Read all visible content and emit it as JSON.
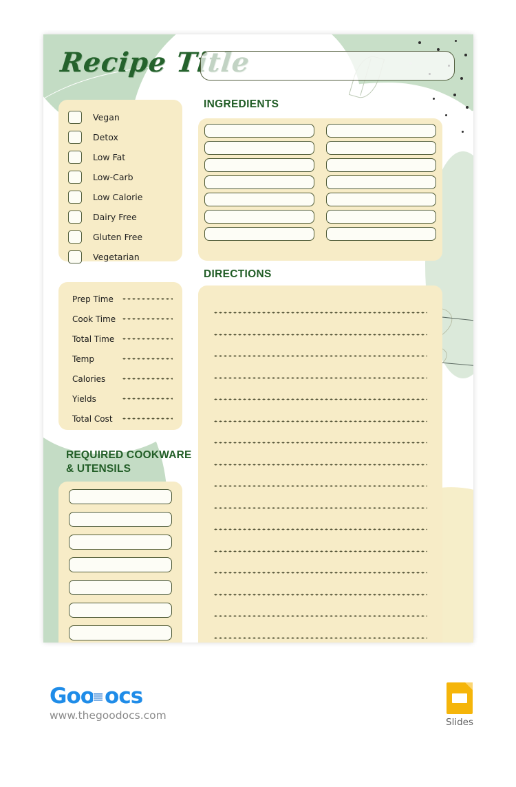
{
  "header": {
    "title": "Recipe Title",
    "title_input_value": "",
    "title_input_placeholder": ""
  },
  "diet": {
    "items": [
      {
        "label": "Vegan",
        "checked": false
      },
      {
        "label": "Detox",
        "checked": false
      },
      {
        "label": "Low Fat",
        "checked": false
      },
      {
        "label": "Low-Carb",
        "checked": false
      },
      {
        "label": "Low Calorie",
        "checked": false
      },
      {
        "label": "Dairy Free",
        "checked": false
      },
      {
        "label": "Gluten Free",
        "checked": false
      },
      {
        "label": "Vegetarian",
        "checked": false
      }
    ]
  },
  "info": {
    "rows": [
      {
        "label": "Prep Time",
        "value": ""
      },
      {
        "label": "Cook Time",
        "value": ""
      },
      {
        "label": "Total Time",
        "value": ""
      },
      {
        "label": "Temp",
        "value": ""
      },
      {
        "label": "Calories",
        "value": ""
      },
      {
        "label": "Yields",
        "value": ""
      },
      {
        "label": "Total Cost",
        "value": ""
      }
    ]
  },
  "cookware": {
    "heading": "REQUIRED COOKWARE & UTENSILS",
    "fields": [
      "",
      "",
      "",
      "",
      "",
      "",
      ""
    ]
  },
  "ingredients": {
    "heading": "INGREDIENTS",
    "rows": [
      {
        "left": "",
        "right": ""
      },
      {
        "left": "",
        "right": ""
      },
      {
        "left": "",
        "right": ""
      },
      {
        "left": "",
        "right": ""
      },
      {
        "left": "",
        "right": ""
      },
      {
        "left": "",
        "right": ""
      },
      {
        "left": "",
        "right": ""
      }
    ]
  },
  "directions": {
    "heading": "DIRECTIONS",
    "line_count": 16,
    "lines": [
      "",
      "",
      "",
      "",
      "",
      "",
      "",
      "",
      "",
      "",
      "",
      "",
      "",
      "",
      "",
      ""
    ]
  },
  "footer": {
    "logo_part1": "Goo",
    "logo_part2": "ocs",
    "url": "www.thegoodocs.com",
    "format_label": "Slides"
  },
  "colors": {
    "green_dark": "#215d26",
    "green_title": "#24622c",
    "green_pale": "#c4dcc5",
    "cream_panel": "#f7ecc7",
    "field_border": "#4e5a36",
    "field_fill": "#fdfdf6",
    "logo_blue": "#1f8ce8",
    "slides_yellow": "#f5b50a",
    "dot_dark": "#2e2e2e"
  }
}
